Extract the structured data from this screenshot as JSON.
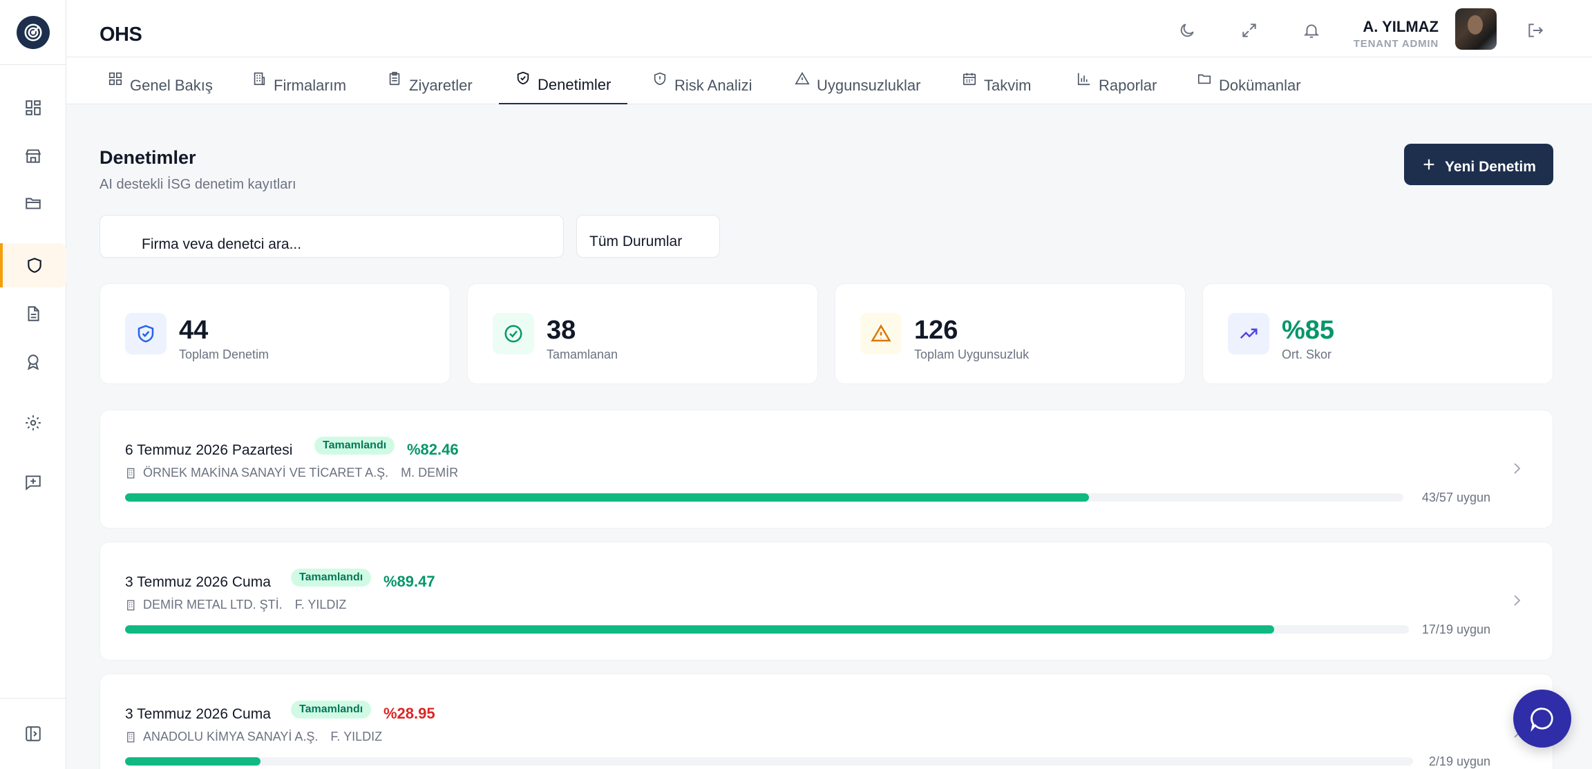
{
  "app": {
    "brand": "OHS"
  },
  "sidebar": {
    "icons": [
      "dashboard-icon",
      "store-icon",
      "folder-icon",
      "shield-icon",
      "document-icon",
      "award-icon",
      "settings-icon",
      "chat-plus-icon"
    ],
    "active": "shield-icon",
    "collapse_icon": "sidebar-collapse-icon"
  },
  "header": {
    "icons": [
      "moon-icon",
      "expand-icon",
      "bell-icon",
      "logout-icon"
    ],
    "user_name": "A. YILMAZ",
    "user_role": "TENANT ADMIN"
  },
  "tabs": [
    {
      "label": "Genel Bakış",
      "icon": "grid-icon"
    },
    {
      "label": "Firmalarım",
      "icon": "building-icon"
    },
    {
      "label": "Ziyaretler",
      "icon": "clipboard-icon"
    },
    {
      "label": "Denetimler",
      "icon": "shield-check-icon",
      "active": true
    },
    {
      "label": "Risk Analizi",
      "icon": "shield-alert-icon"
    },
    {
      "label": "Uygunsuzluklar",
      "icon": "warning-icon"
    },
    {
      "label": "Takvim",
      "icon": "calendar-icon"
    },
    {
      "label": "Raporlar",
      "icon": "bar-chart-icon"
    },
    {
      "label": "Dokümanlar",
      "icon": "folder-icon"
    }
  ],
  "page": {
    "title": "Denetimler",
    "subtitle": "AI destekli İSG denetim kayıtları",
    "new_button": "Yeni Denetim",
    "search_placeholder": "Firma veya denetçi ara...",
    "search_display": "Firma veva denetci ara...",
    "status_filter": "Tüm Durumlar"
  },
  "stats": [
    {
      "value": "44",
      "label": "Toplam Denetim",
      "icon": "shield-check-icon",
      "color": "#2563eb",
      "bg": "#eef2ff"
    },
    {
      "value": "38",
      "label": "Tamamlanan",
      "icon": "check-circle-icon",
      "color": "#059669",
      "bg": "#ecfdf5"
    },
    {
      "value": "126",
      "label": "Toplam Uygunsuzluk",
      "icon": "warning-icon",
      "color": "#d97706",
      "bg": "#fffbeb"
    },
    {
      "value": "%85",
      "label": "Ort. Skor",
      "icon": "trending-up-icon",
      "color": "#059669",
      "bg": "#eef2ff"
    }
  ],
  "audits": [
    {
      "date": "6 Temmuz 2026 Pazartesi",
      "status": "Tamamlandı",
      "score": "%82.46",
      "score_color": "#059669",
      "company": "ÖRNEK MAKİNA SANAYİ VE TİCARET A.Ş.",
      "auditor": "M. DEMİR",
      "progress": 0.754,
      "count": "43/57 uygun"
    },
    {
      "date": "3 Temmuz 2026 Cuma",
      "status": "Tamamlandı",
      "score": "%89.47",
      "score_color": "#059669",
      "company": "DEMİR METAL LTD. ŞTİ.",
      "auditor": "F. YILDIZ",
      "progress": 0.895,
      "count": "17/19 uygun"
    },
    {
      "date": "3 Temmuz 2026 Cuma",
      "status": "Tamamlandı",
      "score": "%28.95",
      "score_color": "#dc2626",
      "company": "ANADOLU KİMYA SANAYİ A.Ş.",
      "auditor": "F. YILDIZ",
      "progress": 0.105,
      "count": "2/19 uygun"
    }
  ],
  "colors": {
    "primary": "#1e2f4d",
    "success": "#10b981",
    "accent": "#f59e0b"
  }
}
